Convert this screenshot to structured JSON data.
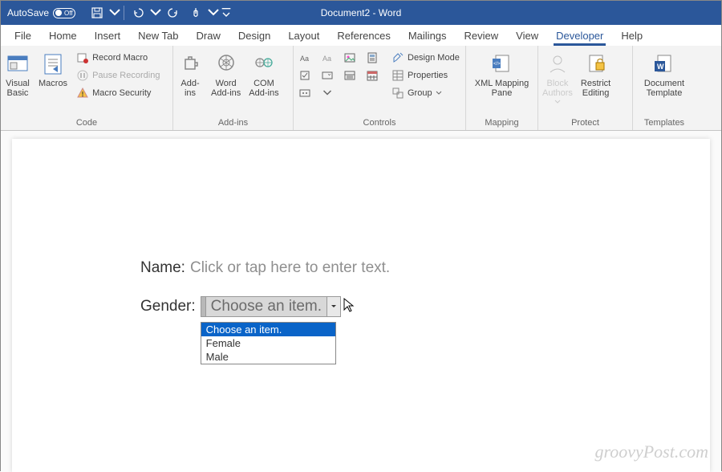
{
  "titlebar": {
    "autosave_label": "AutoSave",
    "autosave_state": "Off",
    "document_title": "Document2  -  Word"
  },
  "tabs": [
    "File",
    "Home",
    "Insert",
    "New Tab",
    "Draw",
    "Design",
    "Layout",
    "References",
    "Mailings",
    "Review",
    "View",
    "Developer",
    "Help"
  ],
  "active_tab": "Developer",
  "ribbon": {
    "code": {
      "visual_basic": "Visual\nBasic",
      "macros": "Macros",
      "record_macro": "Record Macro",
      "pause_recording": "Pause Recording",
      "macro_security": "Macro Security",
      "group": "Code"
    },
    "addins": {
      "addins": "Add-\nins",
      "word_addins": "Word\nAdd-ins",
      "com_addins": "COM\nAdd-ins",
      "group": "Add-ins"
    },
    "controls": {
      "design_mode": "Design Mode",
      "properties": "Properties",
      "group_btn": "Group",
      "group": "Controls"
    },
    "mapping": {
      "xml_mapping": "XML Mapping\nPane",
      "group": "Mapping"
    },
    "protect": {
      "block_authors": "Block\nAuthors",
      "restrict_editing": "Restrict\nEditing",
      "group": "Protect"
    },
    "templates": {
      "document_template": "Document\nTemplate",
      "group": "Templates"
    }
  },
  "document": {
    "name_label": "Name:",
    "name_placeholder": "Click or tap here to enter text.",
    "gender_label": "Gender:",
    "dropdown_text": "Choose an item.",
    "dropdown_items": [
      "Choose an item.",
      "Female",
      "Male"
    ]
  },
  "watermark": "groovyPost.com"
}
